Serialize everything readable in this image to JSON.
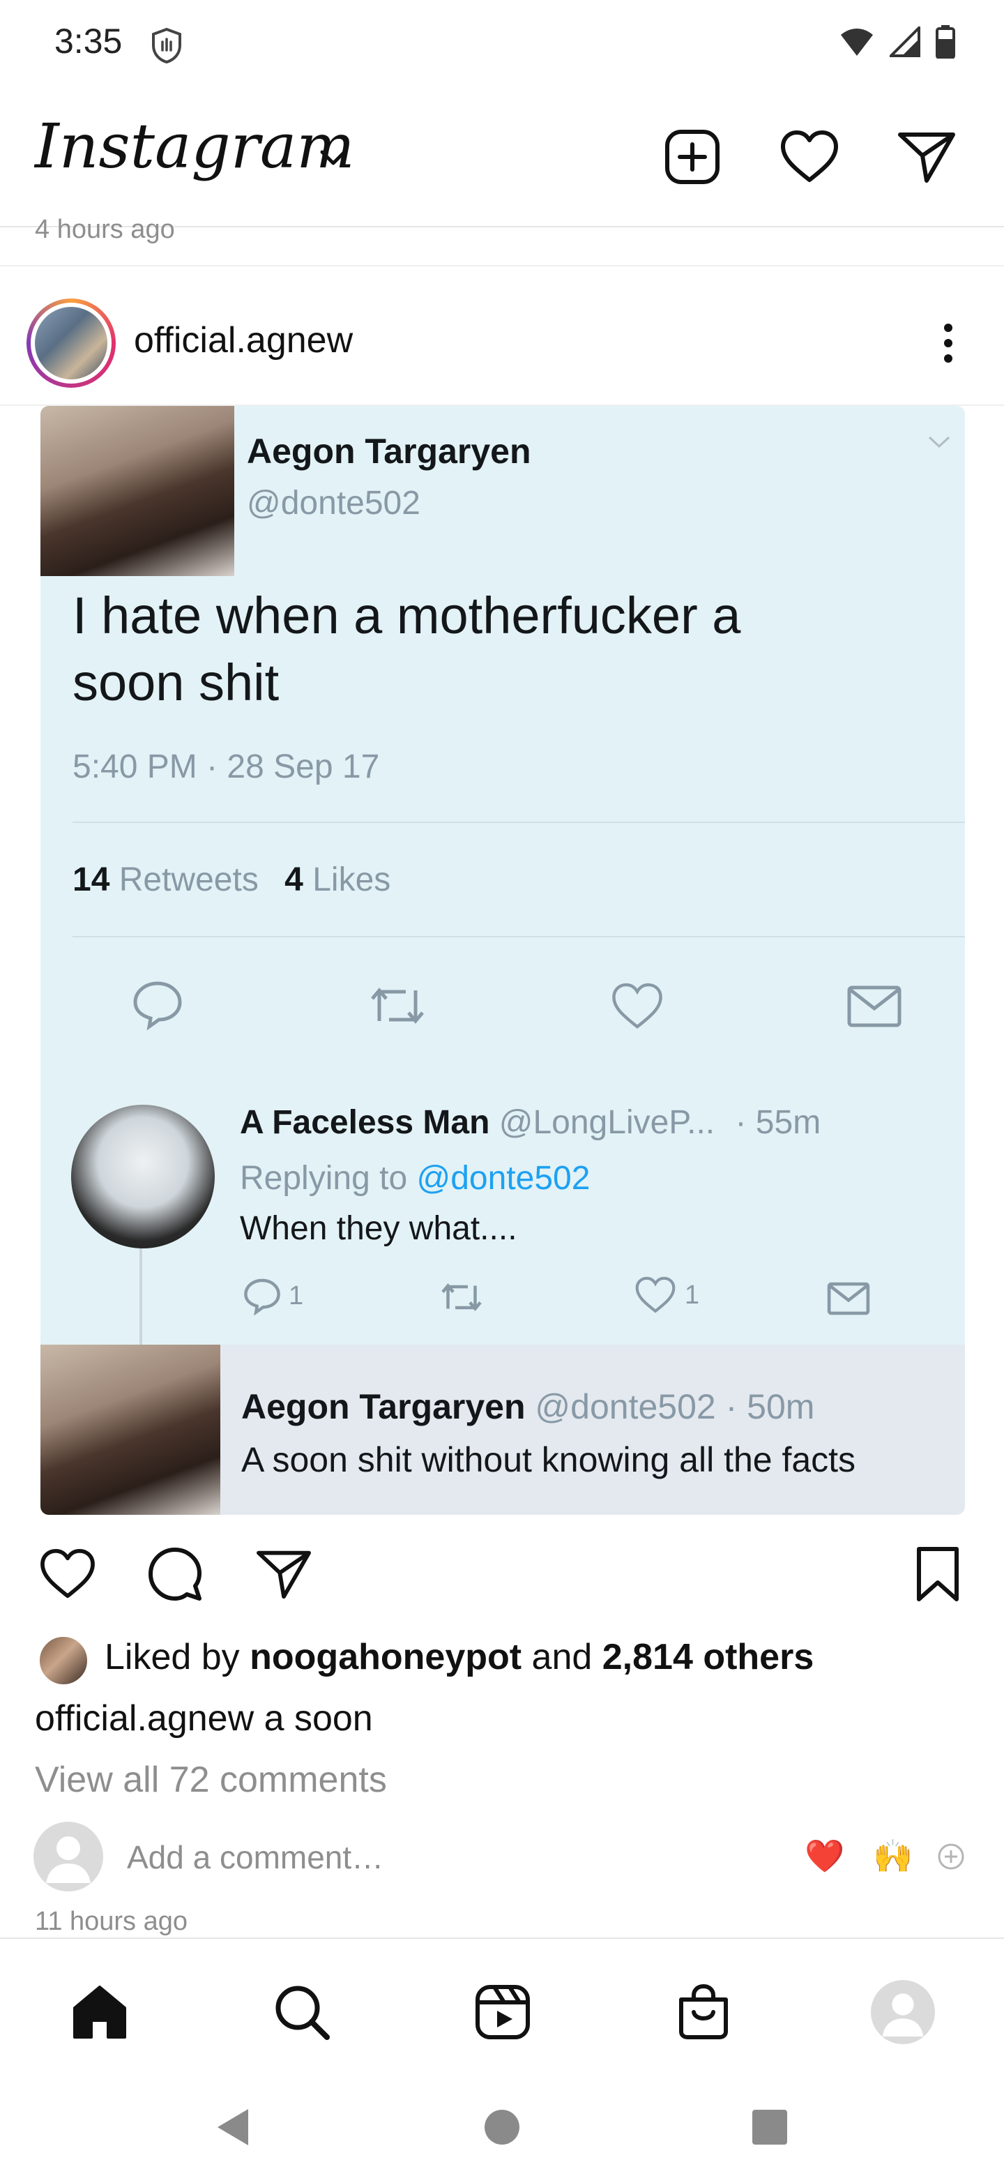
{
  "status_bar": {
    "time": "3:35"
  },
  "header": {
    "logo": "Instagram"
  },
  "prev_post": {
    "time_ago": "4 hours ago"
  },
  "post": {
    "username": "official.agnew",
    "tweet": {
      "author_name": "Aegon Targaryen",
      "author_handle": "@donte502",
      "text_line1": "I hate when a motherfucker a",
      "text_line2": "soon shit",
      "timestamp": "5:40 PM · 28 Sep 17",
      "retweets_count": "14",
      "retweets_label": "Retweets",
      "likes_count": "4",
      "likes_label": "Likes",
      "reply1": {
        "name": "A Faceless Man",
        "handle": "@LongLiveP...",
        "time": "· 55m",
        "replying_to_prefix": "Replying to",
        "replying_to_handle": "@donte502",
        "text": "When they what....",
        "reply_count": "1",
        "like_count": "1"
      },
      "reply2": {
        "name": "Aegon Targaryen",
        "handle_time": "@donte502 · 50m",
        "text": "A soon shit without knowing all the facts"
      }
    },
    "likes": {
      "prefix": "Liked by",
      "user": "noogahoneypot",
      "and": "and",
      "others": "2,814 others"
    },
    "caption": {
      "username": "official.agnew",
      "text": "a soon"
    },
    "view_all_comments": "View all 72 comments",
    "add_comment_placeholder": "Add a comment…",
    "quick_emojis": [
      "❤️",
      "🙌"
    ],
    "time_ago": "11 hours ago"
  }
}
